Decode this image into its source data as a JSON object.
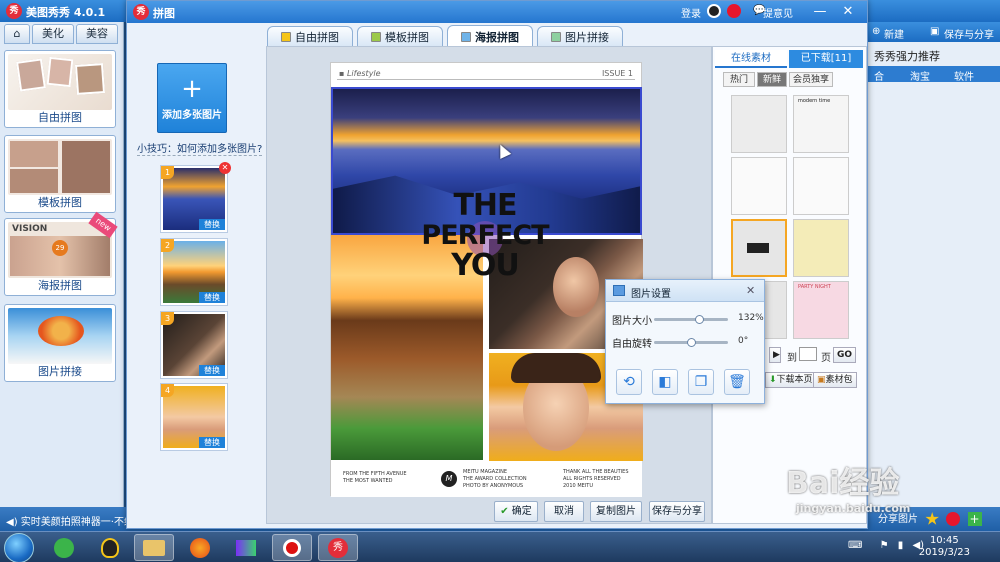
{
  "main_window": {
    "title": "美图秀秀 4.0.1",
    "tabs": [
      "美化",
      "美容"
    ],
    "cards": [
      {
        "label": "自由拼图"
      },
      {
        "label": "模板拼图"
      },
      {
        "label": "海报拼图",
        "badge": "new"
      },
      {
        "label": "图片拼接"
      }
    ],
    "bottom_tip": "实时美颜拍照神器一·不缩图",
    "right": {
      "new_label": "新建",
      "save_share_label": "保存与分享",
      "recommend": "秀秀强力推荐",
      "tabs": [
        "合",
        "淘宝",
        "软件"
      ],
      "share_pic": "分享图片"
    }
  },
  "dialog": {
    "title": "拼图",
    "login": "登录",
    "feedback": "提意见",
    "mode_tabs": [
      {
        "label": "自由拼图",
        "active": false
      },
      {
        "label": "模板拼图",
        "active": false
      },
      {
        "label": "海报拼图",
        "active": true
      },
      {
        "label": "图片拼接",
        "active": false
      }
    ],
    "add_button": "添加多张图片",
    "tip_link": "小技巧：如何添加多张图片?",
    "slots": [
      {
        "num": "1",
        "replace": "替换"
      },
      {
        "num": "2",
        "replace": "替换"
      },
      {
        "num": "3",
        "replace": "替换"
      },
      {
        "num": "4",
        "replace": "替换"
      }
    ],
    "poster": {
      "header": "Lifestyle",
      "issue": "ISSUE 1",
      "headline_1": "THE",
      "headline_2": "PERFECT",
      "headline_3": "YOU",
      "foot_a_1": "FROM THE FIFTH AVENUE",
      "foot_a_2": "THE MOST WANTED",
      "foot_logo": "M",
      "foot_b_1": "MEITU MAGAZINE",
      "foot_b_2": "THE AWARD COLLECTION",
      "foot_b_3": "PHOTO BY ANONYMOUS",
      "foot_c_1": "THANK ALL THE BEAUTIES",
      "foot_c_2": "ALL RIGHTS RESERVED",
      "foot_c_3": "2010 MEITU"
    },
    "actions": {
      "confirm": "确定",
      "cancel": "取消",
      "copy": "复制图片",
      "save_share": "保存与分享"
    },
    "materials": {
      "tab_online": "在线素材",
      "tab_downloaded": "已下载[11]",
      "sub_tabs": [
        "热门",
        "新鲜",
        "会员独享"
      ],
      "tile_1_text": "modern time",
      "tile_2_text": "PARTY NIGHT",
      "page_to": "到",
      "page_unit": "页",
      "go": "GO",
      "download_page": "下载本页",
      "material_pack": "素材包"
    }
  },
  "popup": {
    "title": "图片设置",
    "size_label": "图片大小",
    "size_value": "132%",
    "size_level": 0.62,
    "rotate_label": "自由旋转",
    "rotate_value": "0°",
    "rotate_level": 0.5,
    "buttons": [
      "rotate-icon",
      "flip-icon",
      "layer-icon",
      "delete-icon"
    ]
  },
  "taskbar": {
    "time": "10:45",
    "date": "2019/3/23"
  },
  "watermark": {
    "brand": "Bai经验",
    "url": "jingyan.baidu.com"
  },
  "colors": {
    "accent": "#2576cf",
    "orange": "#f5a623",
    "red": "#e32d3a"
  }
}
